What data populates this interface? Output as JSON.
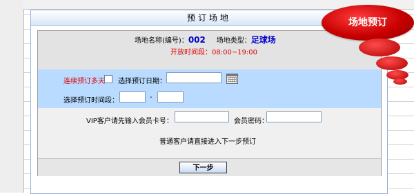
{
  "panel": {
    "title": "预订场地"
  },
  "venue": {
    "name_label": "场地名称(编号)：",
    "code": "002",
    "type_label": "场地类型：",
    "type_value": "足球场",
    "hours": "开放时间段：08:00~19:00"
  },
  "booking": {
    "multi_day_label": "连续预订多天",
    "multi_day_checked": false,
    "date_label": "选择预订日期：",
    "date_value": "",
    "time_label": "选择预订时间段：",
    "time_start": "",
    "time_separator": "-",
    "time_end": ""
  },
  "vip": {
    "card_label": "VIP客户请先输入会员卡号：",
    "card_value": "",
    "password_label": "会员密码：",
    "password_value": "",
    "normal_note": "普通客户请直接进入下一步预订"
  },
  "actions": {
    "next_label": "下一步"
  },
  "badge": {
    "text": "场地预订"
  },
  "colors": {
    "accent_red": "#c80000",
    "info_blue": "#0000cc",
    "row_blue": "#b9dbff"
  }
}
